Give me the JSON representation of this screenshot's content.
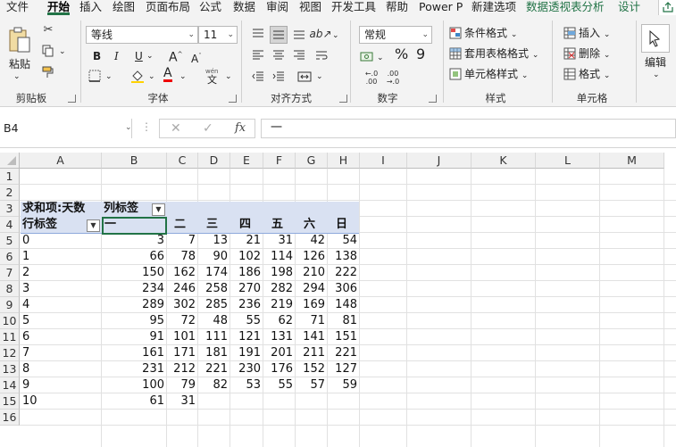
{
  "menu": {
    "tabs": [
      "文件",
      "开始",
      "插入",
      "绘图",
      "页面布局",
      "公式",
      "数据",
      "审阅",
      "视图",
      "开发工具",
      "帮助",
      "Power P",
      "新建选项"
    ],
    "context_tabs": [
      "数据透视表分析",
      "设计"
    ]
  },
  "ribbon": {
    "clipboard": {
      "paste_label": "粘贴",
      "group_label": "剪贴板"
    },
    "font": {
      "font_name": "等线",
      "font_size": "11",
      "bold": "B",
      "italic": "I",
      "underline": "U",
      "grow": "A",
      "shrink": "A",
      "font_color_letter": "A",
      "wen_label": "wén",
      "wen_char": "文",
      "group_label": "字体"
    },
    "alignment": {
      "group_label": "对齐方式"
    },
    "number": {
      "format": "常规",
      "percent": "%",
      "comma": "9",
      "dec_inc": "←.0\n.00",
      "dec_dec": ".00\n→.0",
      "group_label": "数字"
    },
    "styles": {
      "conditional": "条件格式",
      "table_format": "套用表格格式",
      "cell_styles": "单元格样式",
      "group_label": "样式"
    },
    "cells": {
      "insert": "插入",
      "delete": "删除",
      "format": "格式",
      "group_label": "单元格"
    },
    "editing": {
      "label": "编辑"
    }
  },
  "formula_bar": {
    "name_box": "B4",
    "fx": "fx",
    "content": "一"
  },
  "columns": [
    "A",
    "B",
    "C",
    "D",
    "E",
    "F",
    "G",
    "H",
    "I",
    "J",
    "K",
    "L",
    "M"
  ],
  "rows": [
    "1",
    "2",
    "3",
    "4",
    "5",
    "6",
    "7",
    "8",
    "9",
    "10",
    "11",
    "12",
    "13",
    "14",
    "15",
    "16"
  ],
  "pivot": {
    "corner_label": "求和项:天数",
    "col_label": "列标签",
    "row_label": "行标签",
    "col_headers": [
      "一",
      "二",
      "三",
      "四",
      "五",
      "六",
      "日"
    ],
    "rows": [
      {
        "label": "0",
        "values": [
          "3",
          "7",
          "13",
          "21",
          "31",
          "42",
          "54"
        ]
      },
      {
        "label": "1",
        "values": [
          "66",
          "78",
          "90",
          "102",
          "114",
          "126",
          "138"
        ]
      },
      {
        "label": "2",
        "values": [
          "150",
          "162",
          "174",
          "186",
          "198",
          "210",
          "222"
        ]
      },
      {
        "label": "3",
        "values": [
          "234",
          "246",
          "258",
          "270",
          "282",
          "294",
          "306"
        ]
      },
      {
        "label": "4",
        "values": [
          "289",
          "302",
          "285",
          "236",
          "219",
          "169",
          "148"
        ]
      },
      {
        "label": "5",
        "values": [
          "95",
          "72",
          "48",
          "55",
          "62",
          "71",
          "81"
        ]
      },
      {
        "label": "6",
        "values": [
          "91",
          "101",
          "111",
          "121",
          "131",
          "141",
          "151"
        ]
      },
      {
        "label": "7",
        "values": [
          "161",
          "171",
          "181",
          "191",
          "201",
          "211",
          "221"
        ]
      },
      {
        "label": "8",
        "values": [
          "231",
          "212",
          "221",
          "230",
          "176",
          "152",
          "127"
        ]
      },
      {
        "label": "9",
        "values": [
          "100",
          "79",
          "82",
          "53",
          "55",
          "57",
          "59"
        ]
      },
      {
        "label": "10",
        "values": [
          "61",
          "31",
          "",
          "",
          "",
          "",
          ""
        ]
      }
    ]
  }
}
